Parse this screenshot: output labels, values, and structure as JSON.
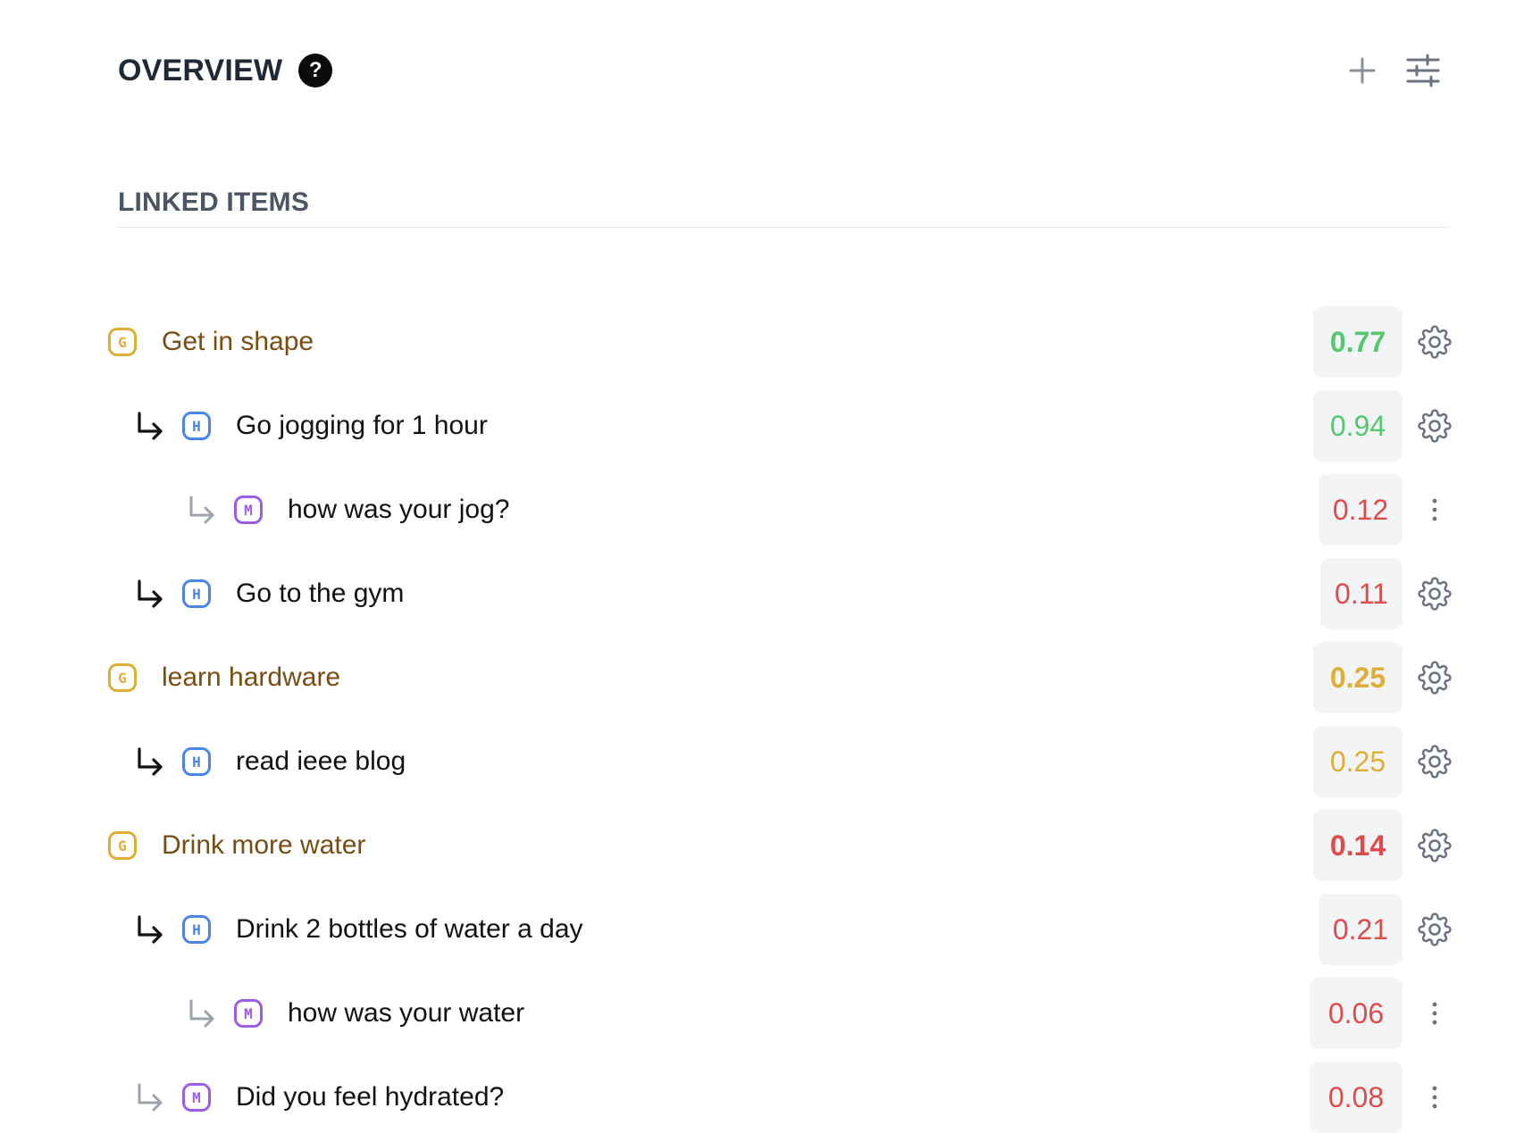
{
  "header": {
    "title": "OVERVIEW",
    "help_icon": "?"
  },
  "section": {
    "title": "LINKED ITEMS"
  },
  "items": [
    {
      "type": "G",
      "label": "Get in shape",
      "score": "0.77",
      "score_color": "#55c76f",
      "score_bold": true,
      "action": "settings"
    },
    {
      "type": "H",
      "label": "Go jogging for 1 hour",
      "score": "0.94",
      "score_color": "#55c76f",
      "score_bold": false,
      "action": "settings"
    },
    {
      "type": "M",
      "label": "how was your jog?",
      "score": "0.12",
      "score_color": "#df4b4b",
      "score_bold": false,
      "action": "menu"
    },
    {
      "type": "H",
      "label": "Go to the gym",
      "score": "0.11",
      "score_color": "#df4b4b",
      "score_bold": false,
      "action": "settings"
    },
    {
      "type": "G",
      "label": "learn hardware",
      "score": "0.25",
      "score_color": "#e0ad35",
      "score_bold": true,
      "action": "settings"
    },
    {
      "type": "H",
      "label": "read ieee blog",
      "score": "0.25",
      "score_color": "#e0ad35",
      "score_bold": false,
      "action": "settings"
    },
    {
      "type": "G",
      "label": "Drink more water",
      "score": "0.14",
      "score_color": "#df4b4b",
      "score_bold": true,
      "action": "settings"
    },
    {
      "type": "H",
      "label": "Drink 2 bottles of water a day",
      "score": "0.21",
      "score_color": "#df4b4b",
      "score_bold": false,
      "action": "settings"
    },
    {
      "type": "M",
      "label": "how was your water",
      "score": "0.06",
      "score_color": "#df4b4b",
      "score_bold": false,
      "action": "menu"
    },
    {
      "type": "M",
      "label": "Did you feel hydrated?",
      "score": "0.08",
      "score_color": "#df4b4b",
      "score_bold": false,
      "action": "menu"
    }
  ],
  "colors": {
    "goal_badge": "#e0ad35",
    "habit_badge": "#4a86e8",
    "metric_badge": "#9b5de5",
    "goal_text": "#7a4c12",
    "score_bg": "#f3f4f6"
  }
}
